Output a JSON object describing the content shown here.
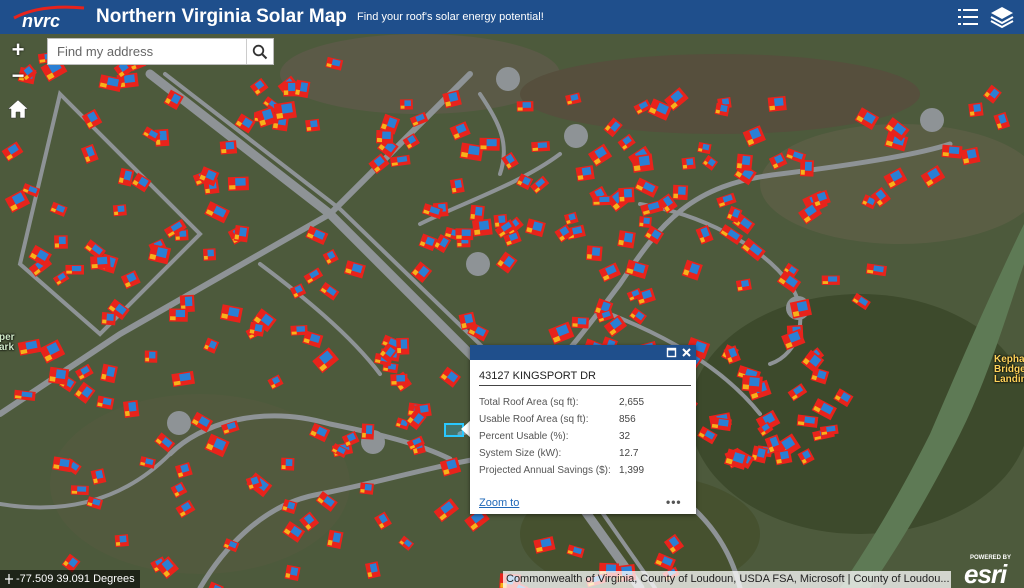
{
  "header": {
    "logo_text": "nvrc",
    "title": "Northern Virginia Solar Map",
    "subtitle": "Find your roof's solar energy potential!",
    "buttons": [
      {
        "name": "legend",
        "icon": "list-icon"
      },
      {
        "name": "layers",
        "icon": "layers-icon"
      }
    ]
  },
  "controls": {
    "zoom_in": "+",
    "zoom_out": "−",
    "home_icon": "home-icon"
  },
  "search": {
    "placeholder": "Find my address",
    "value": "",
    "icon": "search-icon"
  },
  "popup": {
    "title": "43127 KINGSPORT DR",
    "attributes": [
      {
        "label": "Total Roof Area (sq ft):",
        "value": "2,655"
      },
      {
        "label": "Usable Roof Area (sq ft):",
        "value": "856"
      },
      {
        "label": "Percent Usable (%):",
        "value": "32"
      },
      {
        "label": "System Size (kW):",
        "value": "12.7"
      },
      {
        "label": "Projected Annual Savings ($):",
        "value": "1,399"
      }
    ],
    "zoom_to": "Zoom to",
    "more": "•••"
  },
  "map": {
    "coordinates": "-77.509 39.091 Degrees",
    "attribution": "Commonwealth of Virginia, County of Loudoun, USDA FSA, Microsoft | County of Loudou...",
    "powered_by": "POWERED BY",
    "esri": "esri",
    "labels": {
      "kephart": "Kephar\nBridge\nLandin",
      "park": "per\nark"
    }
  },
  "colors": {
    "header": "#1f4f8c",
    "solar_high": "#e8231c",
    "solar_mid": "#f7b21a",
    "solar_low": "#2a7fd4",
    "road": "#8a8f92",
    "selection": "#29c8ff"
  }
}
